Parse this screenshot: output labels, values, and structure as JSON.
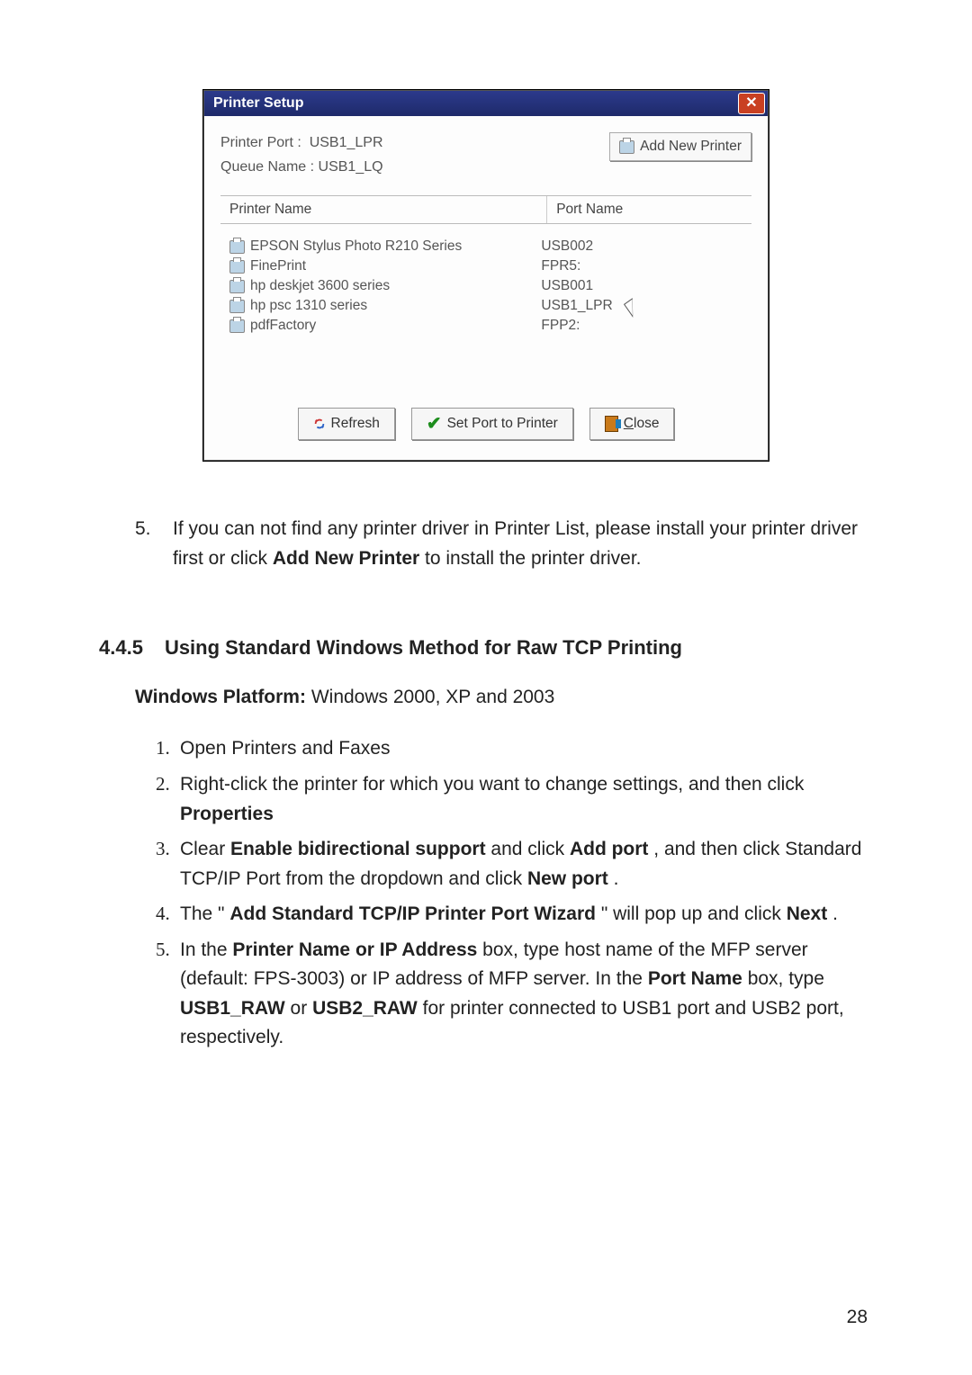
{
  "dialog": {
    "title": "Printer Setup",
    "printer_port_label": "Printer Port :",
    "printer_port_value": "USB1_LPR",
    "queue_name_label": "Queue Name :",
    "queue_name_value": "USB1_LQ",
    "add_new_printer_label": "Add New Printer",
    "headers": {
      "printer_name": "Printer Name",
      "port_name": "Port Name"
    },
    "rows": [
      {
        "name": "EPSON Stylus Photo R210 Series",
        "port": "USB002"
      },
      {
        "name": "FinePrint",
        "port": "FPR5:"
      },
      {
        "name": "hp deskjet 3600 series",
        "port": "USB001"
      },
      {
        "name": "hp psc 1310 series",
        "port": "USB1_LPR"
      },
      {
        "name": "pdfFactory",
        "port": "FPP2:"
      }
    ],
    "buttons": {
      "refresh": "Refresh",
      "set_port": "Set Port to Printer",
      "close": "Close",
      "close_mnemonic": "C"
    }
  },
  "doc": {
    "step5": {
      "num": "5.",
      "text_before_bold": "If you can not find any printer driver in Printer List, please install your printer driver first or click ",
      "bold": "Add New Printer",
      "text_after_bold": " to install the printer driver."
    },
    "section_number": "4.4.5",
    "section_title": "Using Standard Windows Method for Raw TCP Printing",
    "platform_label": "Windows Platform:",
    "platform_value": " Windows 2000, XP and 2003",
    "steps": {
      "s1": "Open Printers and Faxes",
      "s2_a": "Right-click the printer for which you want to change settings, and then click ",
      "s2_b": "Properties",
      "s3_a": "Clear ",
      "s3_b": "Enable bidirectional support",
      "s3_c": " and click ",
      "s3_d": "Add port",
      "s3_e": ", and then click Standard TCP/IP Port from the dropdown and click ",
      "s3_f": "New port",
      "s3_g": ".",
      "s4_a": "The \"",
      "s4_b": "Add Standard TCP/IP Printer Port Wizard",
      "s4_c": "\" will pop up and click ",
      "s4_d": "Next",
      "s4_e": ".",
      "s5_a": "In the ",
      "s5_b": "Printer Name or IP Address",
      "s5_c": " box, type host name of the MFP server (default: FPS-3003) or IP address of MFP server. In the ",
      "s5_d": "Port Name",
      "s5_e": " box, type ",
      "s5_f": "USB1_RAW",
      "s5_g": " or ",
      "s5_h": "USB2_RAW",
      "s5_i": " for printer connected to USB1 port and USB2 port, respectively."
    },
    "page_number": "28"
  }
}
